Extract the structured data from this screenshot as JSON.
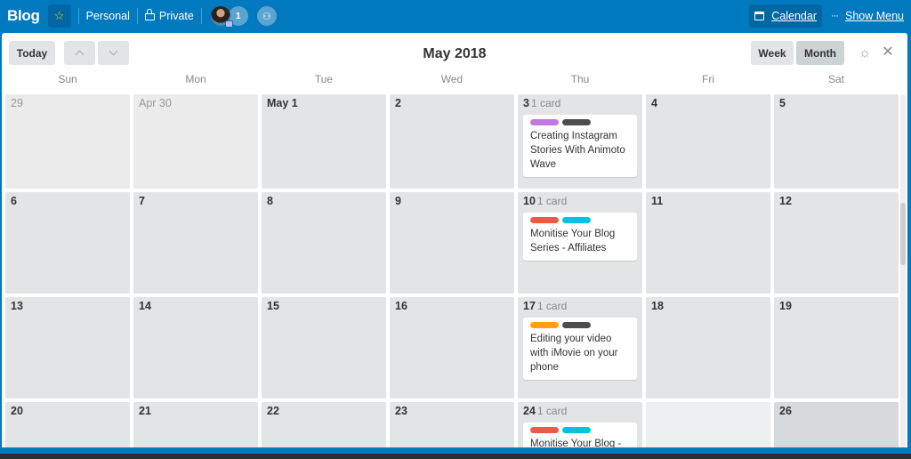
{
  "header": {
    "board_title": "Blog",
    "star_icon": "star-icon",
    "team_label": "Personal",
    "visibility_label": "Private",
    "member_count": "1",
    "calendar_label": "Calendar",
    "show_menu_label": "Show Menu"
  },
  "toolbar": {
    "today_label": "Today",
    "month_title": "May 2018",
    "week_label": "Week",
    "month_label": "Month",
    "active_view": "Month"
  },
  "weekdays": [
    "Sun",
    "Mon",
    "Tue",
    "Wed",
    "Thu",
    "Fri",
    "Sat"
  ],
  "label_colors": {
    "purple": "#c377e0",
    "dark": "#4d4d4d",
    "red": "#eb5a46",
    "sky": "#00c2e0",
    "orange": "#ff9f1a"
  },
  "weeks": [
    [
      {
        "date": "29",
        "other_month": true
      },
      {
        "date": "Apr 30",
        "other_month": true
      },
      {
        "date": "May 1"
      },
      {
        "date": "2"
      },
      {
        "date": "3",
        "count": "1 card",
        "card": {
          "labels": [
            "#c377e0",
            "#4d4d4d"
          ],
          "title": "Creating Instagram Stories With Animoto Wave"
        }
      },
      {
        "date": "4"
      },
      {
        "date": "5"
      }
    ],
    [
      {
        "date": "6"
      },
      {
        "date": "7"
      },
      {
        "date": "8"
      },
      {
        "date": "9"
      },
      {
        "date": "10",
        "count": "1 card",
        "card": {
          "labels": [
            "#eb5a46",
            "#00c2e0"
          ],
          "title": "Monitise Your Blog Series - Affiliates"
        }
      },
      {
        "date": "11"
      },
      {
        "date": "12"
      }
    ],
    [
      {
        "date": "13"
      },
      {
        "date": "14"
      },
      {
        "date": "15"
      },
      {
        "date": "16"
      },
      {
        "date": "17",
        "count": "1 card",
        "card": {
          "labels": [
            "#ff9f1a",
            "#4d4d4d"
          ],
          "title": "Editing your video with iMovie on your phone"
        }
      },
      {
        "date": "18"
      },
      {
        "date": "19"
      }
    ],
    [
      {
        "date": "20"
      },
      {
        "date": "21"
      },
      {
        "date": "22"
      },
      {
        "date": "23"
      },
      {
        "date": "24",
        "count": "1 card",
        "card": {
          "labels": [
            "#eb5a46",
            "#00c2e0"
          ],
          "title": "Monitise Your Blog -"
        }
      },
      {
        "date": "",
        "hovered": true
      },
      {
        "date": "26",
        "highlight": true
      }
    ]
  ]
}
